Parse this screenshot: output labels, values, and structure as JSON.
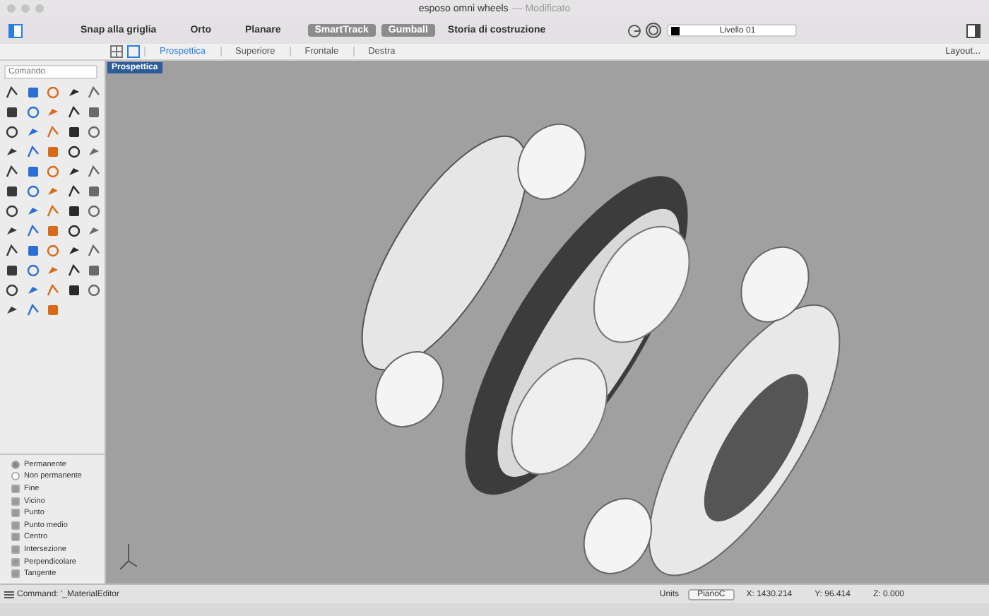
{
  "window": {
    "title": "esposo omni wheels",
    "status": "— Modificato"
  },
  "toolbar": {
    "toggles": [
      {
        "label": "Snap alla griglia",
        "on": false
      },
      {
        "label": "Orto",
        "on": false
      },
      {
        "label": "Planare",
        "on": false
      },
      {
        "label": "SmartTrack",
        "on": true
      },
      {
        "label": "Gumball",
        "on": true
      },
      {
        "label": "Storia di costruzione",
        "on": false
      }
    ],
    "layer": {
      "name": "Livello 01",
      "color": "#000000"
    }
  },
  "view_tabs": [
    {
      "label": "Prospettica",
      "selected": true
    },
    {
      "label": "Superiore",
      "selected": false
    },
    {
      "label": "Frontale",
      "selected": false
    },
    {
      "label": "Destra",
      "selected": false
    }
  ],
  "layout_button": "Layout...",
  "command_field": {
    "placeholder": "Comando"
  },
  "viewport": {
    "label": "Prospettica"
  },
  "osnap": {
    "modes": [
      {
        "label": "Permanente",
        "selected": true
      },
      {
        "label": "Non permanente",
        "selected": false
      }
    ],
    "items": [
      {
        "label": "Fine",
        "checked": true
      },
      {
        "label": "Vicino",
        "checked": true
      },
      {
        "label": "Punto",
        "checked": true
      },
      {
        "label": "Punto medio",
        "checked": true
      },
      {
        "label": "Centro",
        "checked": true
      },
      {
        "label": "Intersezione",
        "checked": true
      },
      {
        "label": "Perpendicolare",
        "checked": true
      },
      {
        "label": "Tangente",
        "checked": true
      }
    ]
  },
  "status_bar": {
    "command": "Command: '_MaterialEditor",
    "units_label": "Units",
    "units_value": "PianoC",
    "x": "X: 1430.214",
    "y": "Y: 96.414",
    "z": "Z: 0.000"
  }
}
